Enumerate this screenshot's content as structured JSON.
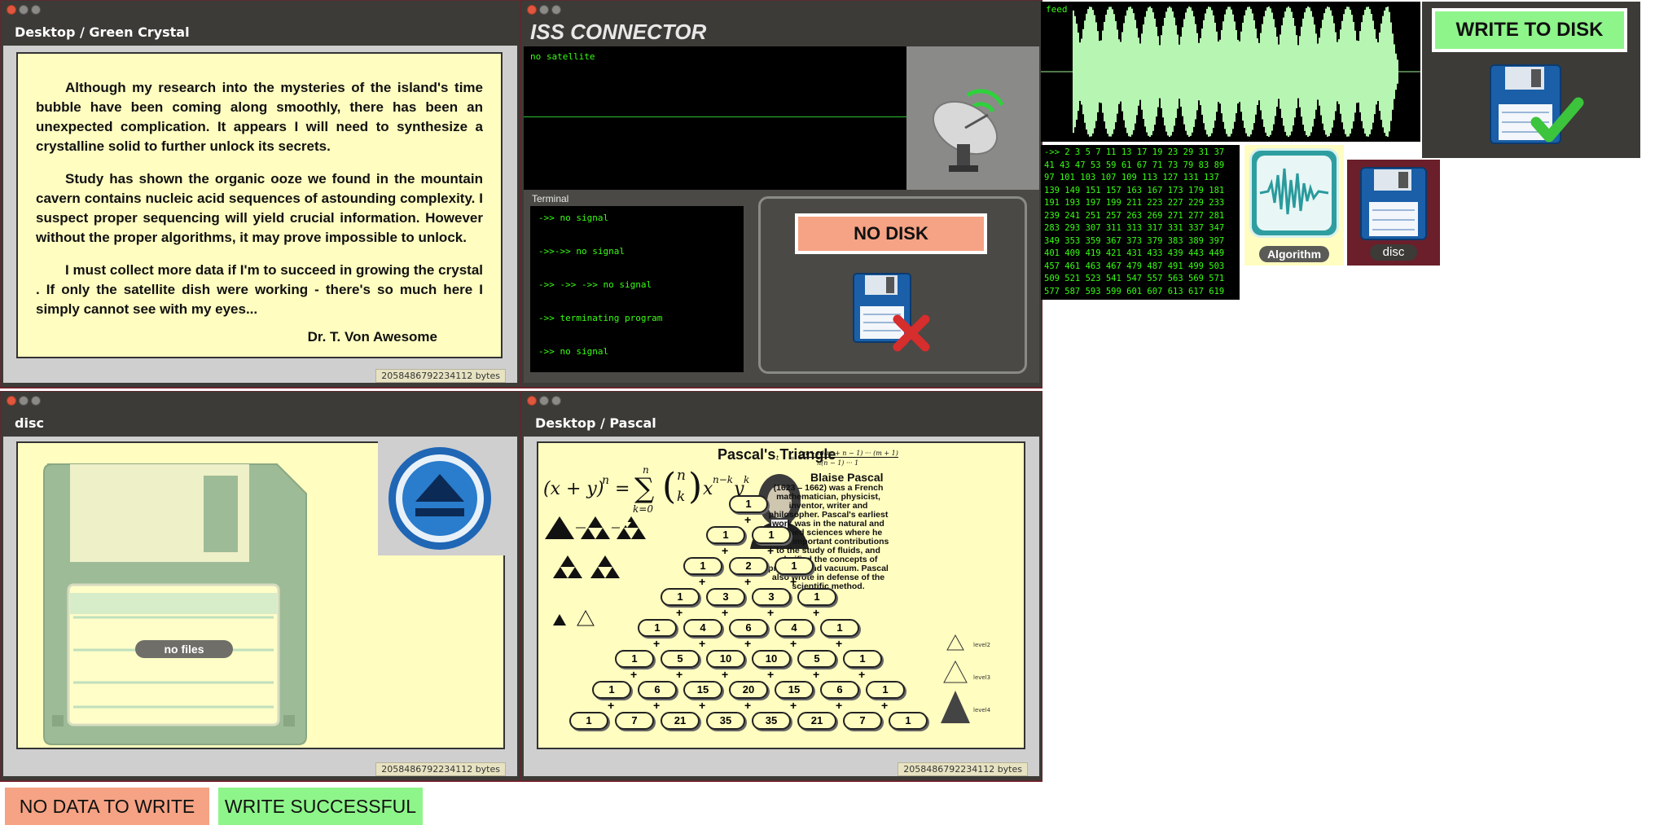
{
  "colors": {
    "window_chrome": "#3c3b37",
    "paper": "#fffdc0",
    "terminal_bg": "#000000",
    "terminal_green": "#39ff14",
    "error": "#f5a384",
    "success": "#8ef58a",
    "accent_border": "#7a1d28"
  },
  "green_crystal_window": {
    "title": "Desktop  /  Green Crystal",
    "paragraphs": [
      "Although my research into the mysteries of the island's time bubble have been coming along smoothly, there has been an unexpected complication. It appears I will need to synthesize a crystalline solid to further unlock its secrets.",
      "Study has shown the organic ooze we found in the mountain cavern contains nucleic acid sequences of astounding complexity. I suspect proper sequencing will yield crucial information. However without the proper algorithms, it may prove impossible to unlock.",
      "I must collect more data if I'm to succeed in growing the crystal . If only the satellite dish were working - there's so much here I simply cannot see with my eyes..."
    ],
    "signature": "Dr. T. Von Awesome",
    "status": "2058486792234112 bytes"
  },
  "iss_window": {
    "title": "ISS CONNECTOR",
    "monitor_label": "no satellite",
    "terminal_title": "Terminal",
    "terminal_lines": [
      "->> no signal",
      "->>->> no signal",
      "->> ->> ->> no signal",
      "->> terminating program",
      "->> no signal"
    ],
    "no_disk_label": "NO DISK",
    "satellite_icon": "satellite-dish-icon",
    "disk_error_icon": "floppy-disk-x-icon"
  },
  "feed_panel": {
    "label": "feed"
  },
  "write_panel": {
    "label": "WRITE TO DISK",
    "icon": "floppy-disk-check-icon"
  },
  "primes_panel": {
    "lines": [
      "->> 2 3 5 7 11 13 17 19 23 29 31 37",
      "41 43 47 53 59 61 67 71 73 79 83 89",
      "97 101 103 107 109 113 127 131 137",
      "139 149 151 157 163 167 173 179 181",
      "191 193 197 199 211 223 227 229 233",
      "239 241 251 257 263 269 271 277 281",
      "283 293 307 311 313 317 331 337 347",
      "349 353 359 367 373 379 383 389 397",
      "401 409 419 421 431 433 439 443 449",
      "457 461 463 467 479 487 491 499 503",
      "509 521 523 541 547 557 563 569 571",
      "577 587 593 599 601 607 613 617 619"
    ]
  },
  "algorithm_icon": {
    "label": "Algorithm"
  },
  "disc_icon": {
    "label": "disc"
  },
  "disc_window": {
    "title": "disc",
    "empty_label": "no files",
    "eject_icon": "eject-icon",
    "status": "2058486792234112 bytes"
  },
  "pascal_window": {
    "title": "Desktop  /  Pascal",
    "heading": "Pascal's Triangle",
    "formula_lhs": "(x + y)",
    "formula_n": "n",
    "formula_eq": "=",
    "formula_rest": "x",
    "formula_sum_top": "n",
    "formula_sum_bottom": "k=0",
    "formula_exp1": "n−k",
    "formula_y": "y",
    "formula_exp2": "k",
    "small_formula_lhs": "t",
    "small_formula_num": "(m + n)(m + n − 1) ··· (m + 1)",
    "small_formula_den": "n(n − 1) ··· 1",
    "bio_name": "Blaise Pascal",
    "bio_text": "(1623 – 1662) was a French mathematician, physicist, inventor, writer and philosopher. Pascal's earliest work was in the natural and applied sciences where he made important contributions to the study of fluids, and clarified the concepts of pressure and vacuum. Pascal also wrote in defense of the scientific method.",
    "rows": [
      [
        "1"
      ],
      [
        "1",
        "1"
      ],
      [
        "1",
        "2",
        "1"
      ],
      [
        "1",
        "3",
        "3",
        "1"
      ],
      [
        "1",
        "4",
        "6",
        "4",
        "1"
      ],
      [
        "1",
        "5",
        "10",
        "10",
        "5",
        "1"
      ],
      [
        "1",
        "6",
        "15",
        "20",
        "15",
        "6",
        "1"
      ],
      [
        "1",
        "7",
        "21",
        "35",
        "35",
        "21",
        "7",
        "1"
      ]
    ],
    "level_labels": [
      "level2",
      "level3",
      "level4"
    ],
    "status": "2058486792234112 bytes"
  },
  "bottom_buttons": {
    "no_data": "NO DATA TO WRITE",
    "write_success": "WRITE SUCCESSFUL"
  }
}
